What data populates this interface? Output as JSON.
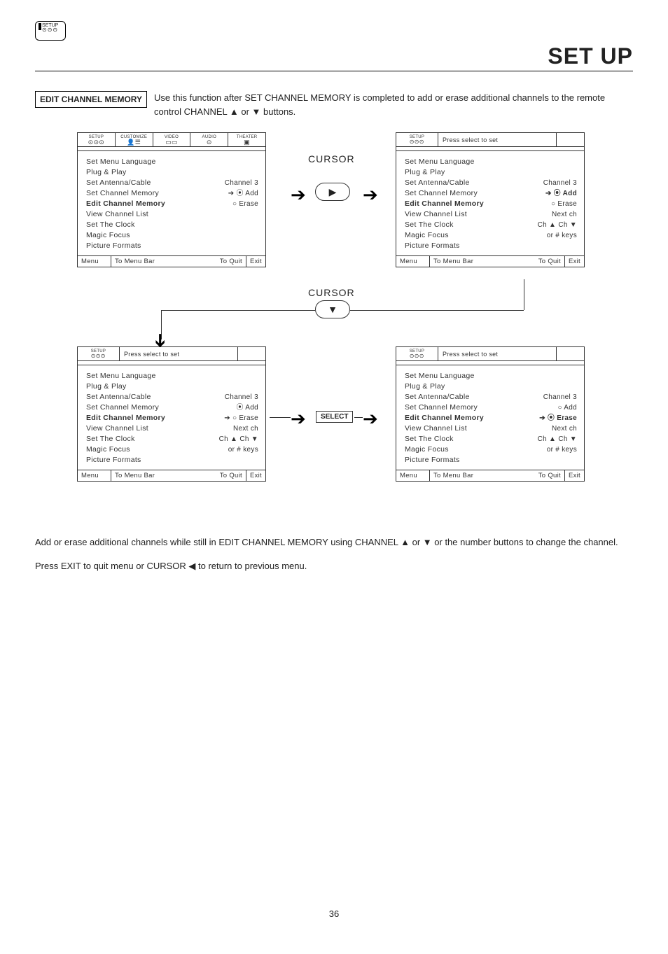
{
  "header": {
    "icon_label": "SETUP",
    "title": "SET UP"
  },
  "chip": "EDIT CHANNEL MEMORY",
  "intro": "Use this function after SET CHANNEL MEMORY is completed to add or erase additional channels to the remote control CHANNEL ▲ or ▼ buttons.",
  "flow": {
    "cursor_label": "CURSOR",
    "select_label": "SELECT"
  },
  "tabs_full": [
    "SETUP",
    "CUSTOMIZE",
    "VIDEO",
    "AUDIO",
    "THEATER"
  ],
  "tab_single": "SETUP",
  "hint_msg": "Press select to set",
  "menu_items": [
    "Set Menu Language",
    "Plug & Play",
    "Set Antenna/Cable",
    "Set Channel Memory",
    "Edit Channel Memory",
    "View Channel List",
    "Set The Clock",
    "Magic Focus",
    "Picture Formats"
  ],
  "panel1_vals": {
    "antenna": "Channel 3",
    "memory_add": "⦿ Add",
    "memory_erase": "○ Erase"
  },
  "panel2_vals": {
    "antenna": "Channel 3",
    "memory_add": "⦿ Add",
    "memory_erase": "○ Erase",
    "view": "Next ch",
    "clock": "Ch ▲ Ch ▼",
    "focus": "or # keys"
  },
  "panel3_vals": {
    "antenna": "Channel 3",
    "memory_add": "⦿ Add",
    "memory_erase": "○ Erase",
    "view": "Next ch",
    "clock": "Ch ▲ Ch ▼",
    "focus": "or # keys"
  },
  "panel4_vals": {
    "antenna": "Channel 3",
    "memory_add": "○ Add",
    "memory_erase": "⦿ Erase",
    "view": "Next ch",
    "clock": "Ch ▲ Ch ▼",
    "focus": "or # keys"
  },
  "footer": {
    "menu": "Menu",
    "tobar": "To Menu Bar",
    "toquit": "To Quit",
    "exit": "Exit"
  },
  "body1": "Add or erase additional channels while still in EDIT CHANNEL MEMORY using CHANNEL ▲ or ▼ or the number buttons to change the channel.",
  "body2": "Press EXIT to quit menu or CURSOR ◀ to return to previous menu.",
  "page": "36"
}
